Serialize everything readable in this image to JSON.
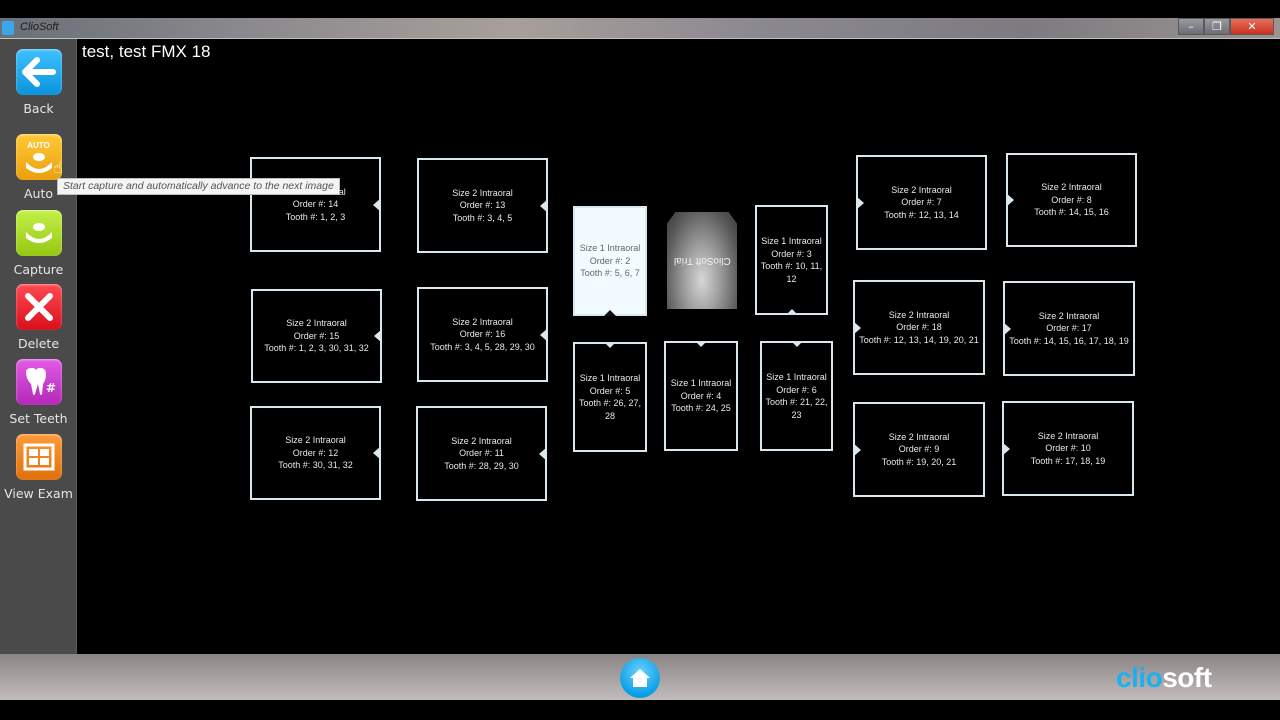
{
  "window": {
    "title": "ClioSoft",
    "controls": {
      "minimize": "–",
      "maximize": "❐",
      "close": "✕"
    }
  },
  "header": {
    "title": "test, test  FMX 18"
  },
  "sidebar": {
    "items": [
      {
        "label": "Back",
        "icon": "back-arrow-icon",
        "color": "#1ea7e8"
      },
      {
        "label": "Auto",
        "icon": "auto-capture-icon",
        "color": "#f5b31c",
        "badge": "AUTO"
      },
      {
        "label": "Capture",
        "icon": "capture-icon",
        "color": "#a6d81e"
      },
      {
        "label": "Delete",
        "icon": "delete-x-icon",
        "color": "#e8222e"
      },
      {
        "label": "Set Teeth",
        "icon": "tooth-hash-icon",
        "color": "#c53ac8"
      },
      {
        "label": "View Exam",
        "icon": "grid-exam-icon",
        "color": "#f07e1c"
      }
    ]
  },
  "tooltip": {
    "text": "Start capture and automatically advance to the next image"
  },
  "slots": [
    {
      "size": "Size 2 Intraoral",
      "order": "Order #: 14",
      "teeth": "Tooth #: 1, 2, 3"
    },
    {
      "size": "Size 2 Intraoral",
      "order": "Order #: 13",
      "teeth": "Tooth #: 3, 4, 5"
    },
    {
      "size": "Size 2 Intraoral",
      "order": "Order #: 15",
      "teeth": "Tooth #: 1, 2, 3, 30, 31, 32"
    },
    {
      "size": "Size 2 Intraoral",
      "order": "Order #: 16",
      "teeth": "Tooth #: 3, 4, 5, 28, 29, 30"
    },
    {
      "size": "Size 2 Intraoral",
      "order": "Order #: 12",
      "teeth": "Tooth #: 30, 31, 32"
    },
    {
      "size": "Size 2 Intraoral",
      "order": "Order #: 11",
      "teeth": "Tooth #: 28, 29, 30"
    },
    {
      "size": "Size 1 Intraoral",
      "order": "Order #: 2",
      "teeth": "Tooth #: 5, 6, 7",
      "active": true
    },
    {
      "size": "Size 1 Intraoral",
      "order": "Order #: 3",
      "teeth": "Tooth #: 10, 11, 12"
    },
    {
      "size": "Size 1 Intraoral",
      "order": "Order #: 5",
      "teeth": "Tooth #: 26, 27, 28"
    },
    {
      "size": "Size 1 Intraoral",
      "order": "Order #: 4",
      "teeth": "Tooth #: 24, 25"
    },
    {
      "size": "Size 1 Intraoral",
      "order": "Order #: 6",
      "teeth": "Tooth #: 21, 22, 23"
    },
    {
      "size": "Size 2 Intraoral",
      "order": "Order #: 7",
      "teeth": "Tooth #: 12, 13, 14"
    },
    {
      "size": "Size 2 Intraoral",
      "order": "Order #: 8",
      "teeth": "Tooth #: 14, 15, 16"
    },
    {
      "size": "Size 2 Intraoral",
      "order": "Order #: 18",
      "teeth": "Tooth #: 12, 13, 14, 19, 20, 21"
    },
    {
      "size": "Size 2 Intraoral",
      "order": "Order #: 17",
      "teeth": "Tooth #: 14, 15, 16, 17, 18, 19"
    },
    {
      "size": "Size 2 Intraoral",
      "order": "Order #: 9",
      "teeth": "Tooth #: 19, 20, 21"
    },
    {
      "size": "Size 2 Intraoral",
      "order": "Order #: 10",
      "teeth": "Tooth #: 17, 18, 19"
    }
  ],
  "xray": {
    "watermark": "ClioSoft Trial"
  },
  "footer": {
    "home_icon": "home-icon",
    "logo_part1": "clio",
    "logo_part2": "soft",
    "logo_colors": {
      "clio": "#1bb0f0",
      "soft": "#ffffff"
    }
  }
}
